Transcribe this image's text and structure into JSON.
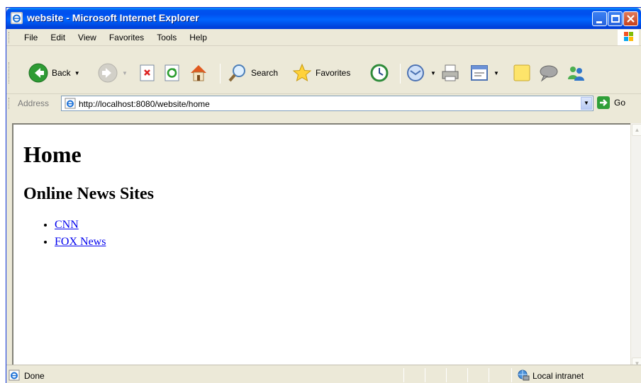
{
  "window": {
    "title": "website - Microsoft Internet Explorer"
  },
  "menu": {
    "items": [
      "File",
      "Edit",
      "View",
      "Favorites",
      "Tools",
      "Help"
    ]
  },
  "toolbar": {
    "back_label": "Back",
    "search_label": "Search",
    "favorites_label": "Favorites"
  },
  "address": {
    "label": "Address",
    "url": "http://localhost:8080/website/home",
    "go_label": "Go"
  },
  "page": {
    "heading": "Home",
    "subheading": "Online News Sites",
    "links": [
      "CNN",
      "FOX News"
    ]
  },
  "status": {
    "text": "Done",
    "zone": "Local intranet"
  },
  "colors": {
    "titlebar_blue": "#0053ee",
    "chrome": "#ece9d8",
    "link": "#0000ee"
  }
}
